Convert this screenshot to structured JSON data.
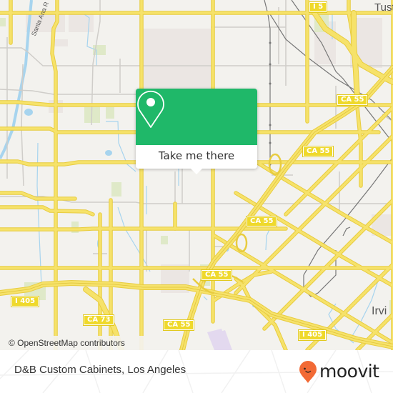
{
  "map": {
    "attribution": "© OpenStreetMap contributors",
    "city_labels": [
      {
        "name": "Tustin",
        "display": "Tust"
      },
      {
        "name": "Irvine",
        "display": "Irvi"
      }
    ],
    "river_label": "Santa Ana R",
    "route_shields": [
      {
        "label": "I 5"
      },
      {
        "label": "CA 55"
      },
      {
        "label": "CA 55"
      },
      {
        "label": "CA 55"
      },
      {
        "label": "CA 55"
      },
      {
        "label": "CA 55"
      },
      {
        "label": "I 405"
      },
      {
        "label": "CA 73"
      },
      {
        "label": "I 405"
      }
    ],
    "colors": {
      "background": "#f3f2ee",
      "road": "#f6e26a",
      "road_outline": "#e8cc3f",
      "water": "#a7d4ee",
      "park": "#d6e8bd",
      "rail": "#777777"
    }
  },
  "popup": {
    "icon": "map-pin-icon",
    "button_label": "Take me there",
    "color": "#1fb869"
  },
  "footer": {
    "place_name": "D&B Custom Cabinets, Los Angeles",
    "brand": {
      "name": "moovit",
      "icon": "moovit-pin-smile-icon",
      "color": "#f26a35"
    }
  }
}
